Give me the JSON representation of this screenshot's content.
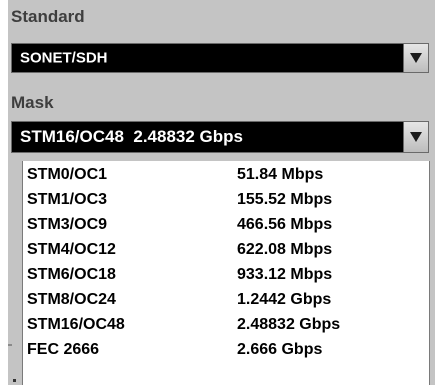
{
  "standard": {
    "label": "Standard",
    "selected": "SONET/SDH"
  },
  "mask": {
    "label": "Mask",
    "selected": "STM16/OC48  2.48832 Gbps",
    "options": [
      {
        "name": "STM0/OC1",
        "rate": "51.84 Mbps"
      },
      {
        "name": "STM1/OC3",
        "rate": "155.52 Mbps"
      },
      {
        "name": "STM3/OC9",
        "rate": "466.56 Mbps"
      },
      {
        "name": "STM4/OC12",
        "rate": "622.08 Mbps"
      },
      {
        "name": "STM6/OC18",
        "rate": "933.12 Mbps"
      },
      {
        "name": "STM8/OC24",
        "rate": "1.2442 Gbps"
      },
      {
        "name": "STM16/OC48",
        "rate": "2.48832 Gbps"
      },
      {
        "name": "FEC 2666",
        "rate": "2.666 Gbps"
      }
    ]
  },
  "icons": {
    "dropdown_arrow": "triangle-down-icon"
  },
  "colors": {
    "panel_bg": "#c4c4c4",
    "field_bg": "#000000",
    "field_text": "#ffffff",
    "label_text": "#3e3e3e"
  }
}
